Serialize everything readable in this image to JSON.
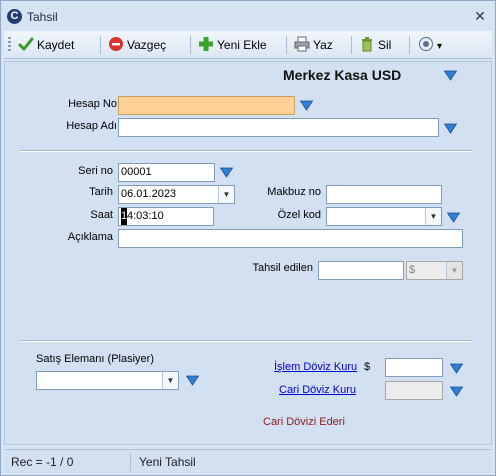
{
  "window": {
    "title": "Tahsil",
    "app_icon_letter": "C",
    "close_glyph": "✕"
  },
  "toolbar": {
    "save_label": "Kaydet",
    "cancel_label": "Vazgeç",
    "new_label": "Yeni Ekle",
    "print_label": "Yaz",
    "delete_label": "Sil",
    "more_glyph": "▾"
  },
  "form": {
    "header_title": "Merkez Kasa USD",
    "hesap_no_label": "Hesap No",
    "hesap_no_value": "",
    "hesap_adi_label": "Hesap Adı",
    "hesap_adi_value": "",
    "seri_no_label": "Seri no",
    "seri_no_value": "00001",
    "tarih_label": "Tarih",
    "tarih_value": "06.01.2023",
    "saat_label": "Saat",
    "saat_caret": "1",
    "saat_value": "4:03:10",
    "makbuz_no_label": "Makbuz no",
    "makbuz_no_value": "",
    "ozel_kod_label": "Özel kod",
    "ozel_kod_value": "",
    "aciklama_label": "Açıklama",
    "aciklama_value": "",
    "tahsil_edilen_label": "Tahsil edilen",
    "tahsil_edilen_value": "",
    "currency_value": "$",
    "satis_elemani_label": "Satış Elemanı (Plasiyer)",
    "satis_elemani_value": "",
    "islem_doviz_label": "İşlem Döviz Kuru",
    "islem_doviz_symbol": "$",
    "islem_doviz_value": "",
    "cari_doviz_label": "Cari Döviz Kuru",
    "cari_doviz_value": "",
    "cari_doviz_ederi_label": "Cari Dövizi Ederi",
    "dropdown_glyph": "▼"
  },
  "status": {
    "rec": "Rec = -1 / 0",
    "mode": "Yeni Tahsil"
  },
  "colors": {
    "accent": "#1f5fb0",
    "highlight_field": "#ffd197",
    "panel": "#d2e0f1"
  }
}
